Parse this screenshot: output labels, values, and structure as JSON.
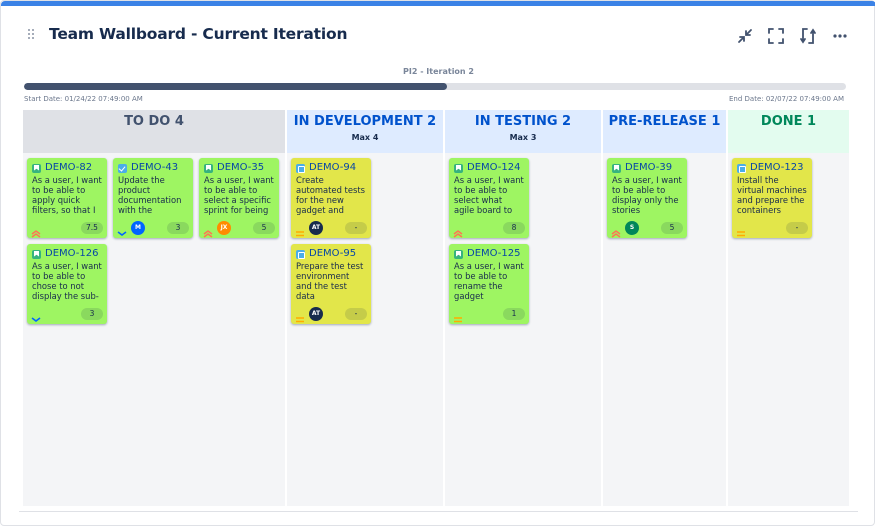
{
  "header": {
    "title": "Team Wallboard - Current Iteration",
    "icons": [
      "minimize-icon",
      "fullscreen-icon",
      "refresh-icon",
      "more-icon"
    ]
  },
  "iteration": {
    "name": "PI2 - Iteration 2",
    "progress": 0.515,
    "start_date": "Start Date: 01/24/22 07:49:00 AM",
    "end_date": "End Date: 02/07/22 07:49:00 AM"
  },
  "colors": {
    "accent": "#3b82e6",
    "todo_head": "#dfe1e6",
    "todo_title": "#42526e",
    "progress_head": "#deebff",
    "progress_title": "#0052cc",
    "done_head": "#e3fcef",
    "done_title": "#00875a",
    "card_green": "#9ef562",
    "card_yellow": "#e2e64a",
    "prio_high": "#ff7452",
    "prio_medium": "#ffab00",
    "prio_low": "#0065ff"
  },
  "columns": [
    {
      "title": "TO DO 4",
      "subtitle": "",
      "variant": "todo",
      "cards": [
        {
          "key": "DEMO-82",
          "type": "story",
          "summary": "As a user, I want to be able to apply quick filters, so that I",
          "priority": "high",
          "avatar": "",
          "avatar_color": "",
          "estimate": "7.5",
          "color": "green"
        },
        {
          "key": "DEMO-43",
          "type": "task",
          "summary": "Update the product documentation with the",
          "priority": "low",
          "avatar": "M",
          "avatar_color": "#0065ff",
          "estimate": "3",
          "color": "green"
        },
        {
          "key": "DEMO-35",
          "type": "story",
          "summary": "As a user, I want to be able to select a specific sprint for being",
          "priority": "high",
          "avatar": "JX",
          "avatar_color": "#ff8b00",
          "estimate": "5",
          "color": "green"
        },
        {
          "key": "DEMO-126",
          "type": "story",
          "summary": "As a user, I want to be able to chose to not display the sub-",
          "priority": "low",
          "avatar": "",
          "avatar_color": "",
          "estimate": "3",
          "color": "green"
        }
      ]
    },
    {
      "title": "IN DEVELOPMENT 2",
      "subtitle": "Max 4",
      "variant": "progress",
      "cards": [
        {
          "key": "DEMO-94",
          "type": "sub",
          "summary": "Create automated tests for the new gadget and",
          "priority": "medium",
          "avatar": "AT",
          "avatar_color": "#172b4d",
          "estimate": "-",
          "color": "yellow"
        },
        {
          "key": "DEMO-95",
          "type": "sub",
          "summary": "Prepare the test environment and the test data",
          "priority": "medium",
          "avatar": "AT",
          "avatar_color": "#172b4d",
          "estimate": "-",
          "color": "yellow"
        }
      ]
    },
    {
      "title": "IN TESTING 2",
      "subtitle": "Max 3",
      "variant": "progress",
      "cards": [
        {
          "key": "DEMO-124",
          "type": "story",
          "summary": "As a user, I want to be able to select what agile board to be",
          "priority": "high",
          "avatar": "",
          "avatar_color": "",
          "estimate": "8",
          "color": "green"
        },
        {
          "key": "DEMO-125",
          "type": "story",
          "summary": "As a user, I want to be able to rename the gadget",
          "priority": "medium",
          "avatar": "",
          "avatar_color": "",
          "estimate": "1",
          "color": "green"
        }
      ]
    },
    {
      "title": "PRE-RELEASE 1",
      "subtitle": "",
      "variant": "progress",
      "cards": [
        {
          "key": "DEMO-39",
          "type": "story",
          "summary": "As a user, I want to be able to display only the stories",
          "priority": "high",
          "avatar": "S",
          "avatar_color": "#00875a",
          "estimate": "5",
          "color": "green"
        }
      ]
    },
    {
      "title": "DONE 1",
      "subtitle": "",
      "variant": "done",
      "cards": [
        {
          "key": "DEMO-123",
          "type": "sub",
          "summary": "Install the virtual machines and prepare the containers",
          "priority": "medium",
          "avatar": "",
          "avatar_color": "",
          "estimate": "-",
          "color": "yellow"
        }
      ]
    }
  ]
}
